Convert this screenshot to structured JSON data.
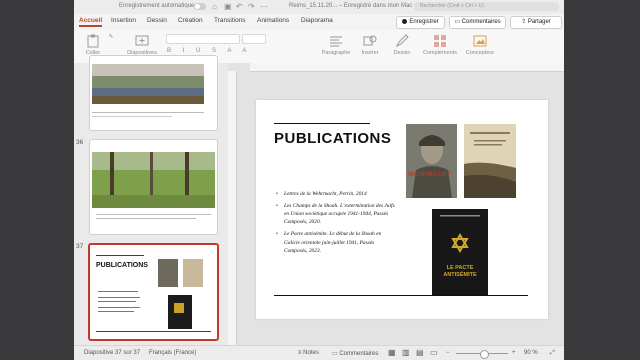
{
  "titlebar": {
    "autosave_label": "Enregistrement automatique",
    "document_title": "Reims_15.11.20... – Enregistré dans mon Mac",
    "search_placeholder": "Rechercher (Cmd + Ctrl + U)"
  },
  "tabs": [
    "Accueil",
    "Insertion",
    "Dessin",
    "Création",
    "Transitions",
    "Animations",
    "Diaporama"
  ],
  "actions": {
    "record": "Enregistrer",
    "comments": "Commentaires",
    "share": "Partager"
  },
  "ribbon": {
    "paste": "Coller",
    "slides": "Diapositives",
    "paragraph": "Paragraphe",
    "insert": "Insérer",
    "draw": "Dessin",
    "addins": "Compléments",
    "designer": "Concepteur"
  },
  "thumbnails": [
    {
      "number": "36"
    },
    {
      "number": "37"
    }
  ],
  "slide": {
    "title": "PUBLICATIONS",
    "bullets": [
      "Lettres de la Wehrmacht, Perrin, 2014",
      "Les Champs de la Shoah. L’extermination des Juifs en Union soviétique occupée 1941-1944, Passés Composés, 2020.",
      "Le Pacte antisémite. Le début de la Shoah en Galicie orientale juin-juillet 1941, Passés Composés, 2023."
    ],
    "book1_cover_text": "WEHRMACHT",
    "book3_cover_text": "LE PACTE ANTISÉMITE"
  },
  "status": {
    "slide_counter": "Diapositive 37 sur 37",
    "language": "Français (France)",
    "notes": "Notes",
    "comments": "Commentaires",
    "zoom": "90 %"
  }
}
